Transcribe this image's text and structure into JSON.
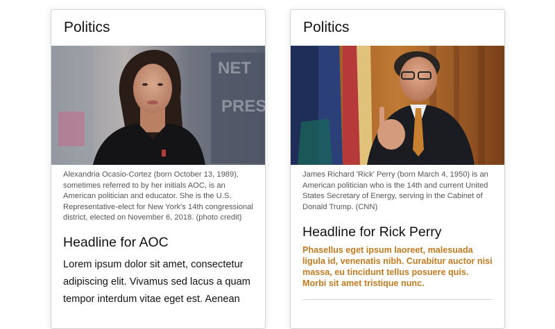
{
  "cards": [
    {
      "category": "Politics",
      "image_alt": "Photo of Alexandria Ocasio-Cortez",
      "caption": "Alexandria Ocasio-Cortez (born October 13, 1989), sometimes referred to by her initials AOC, is an American politician and educator. She is the U.S. Representative-elect for New York's 14th congressional district, elected on November 6, 2018. (photo credit)",
      "headline": "Headline for AOC",
      "body": "Lorem ipsum dolor sit amet, consectetur adipiscing elit. Vivamus sed lacus a quam tempor interdum vitae eget est. Aenean"
    },
    {
      "category": "Politics",
      "image_alt": "Photo of Rick Perry",
      "caption": "James Richard 'Rick' Perry (born March 4, 1950) is an American politician who is the 14th and current United States Secretary of Energy, serving in the Cabinet of Donald Trump. (CNN)",
      "headline": "Headline for Rick Perry",
      "body": "Phasellus eget ipsum laoreet, malesuada ligula id, venenatis nibh. Curabitur auctor nisi massa, eu tincidunt tellus posuere quis. Morbi sit amet tristique nunc."
    }
  ],
  "colors": {
    "highlight_text": "#c27a1e",
    "card_border": "#d2d2d2"
  }
}
